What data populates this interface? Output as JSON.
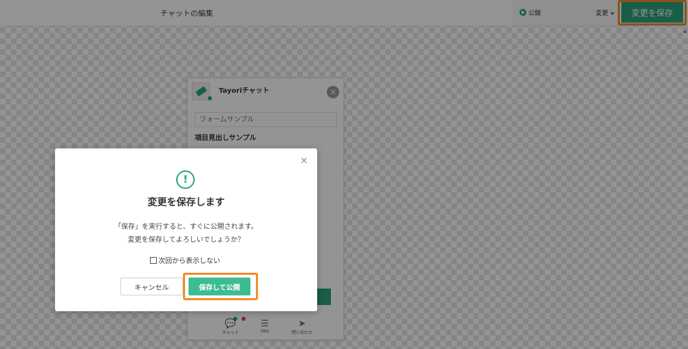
{
  "header": {
    "title": "チャットの編集",
    "publish_status": "公開",
    "change_selector": "変更",
    "save_button": "変更を保存"
  },
  "widget": {
    "title": "Tayoriチャット",
    "close_glyph": "×",
    "input_placeholder": "フォームサンプル",
    "heading": "項目見出しサンプル",
    "nav": [
      {
        "label": "チャット",
        "icon": "chat-icon"
      },
      {
        "label": "FAQ",
        "icon": "faq-icon"
      },
      {
        "label": "問い合わせ",
        "icon": "send-icon"
      }
    ]
  },
  "modal": {
    "close_glyph": "×",
    "alert_glyph": "!",
    "title": "変更を保存します",
    "message_line1": "「保存」を実行すると、すぐに公開されます。",
    "message_line2": "変更を保存してよろしいでしょうか？",
    "checkbox_label": "次回から表示しない",
    "checkbox_checked": false,
    "cancel_label": "キャンセル",
    "publish_label": "保存して公開"
  },
  "colors": {
    "accent": "#2aa37e",
    "highlight": "#f28c28"
  }
}
